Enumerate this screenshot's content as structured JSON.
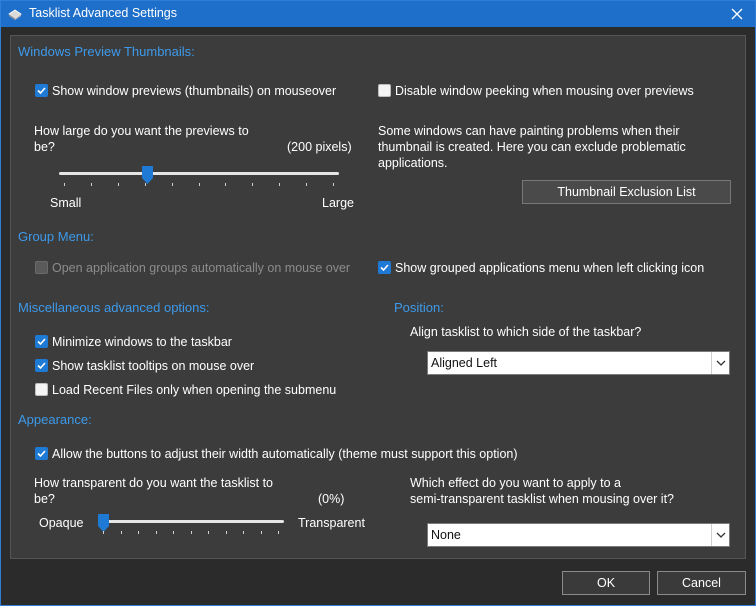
{
  "window": {
    "title": "Tasklist Advanced Settings",
    "accent": "#1e6fc9"
  },
  "thumbs": {
    "heading": "Windows Preview Thumbnails:",
    "show_previews": {
      "label": "Show window previews (thumbnails) on mouseover",
      "checked": true
    },
    "disable_peek": {
      "label": "Disable window peeking when mousing over previews",
      "checked": false
    },
    "size_question_line1": "How large do you want the previews to",
    "size_question_line2": "be?",
    "size_value": "(200 pixels)",
    "size_slider_fraction": 0.31,
    "size_min_label": "Small",
    "size_max_label": "Large",
    "exclusion_text_line1": "Some windows can have painting problems when their",
    "exclusion_text_line2": "thumbnail is created. Here you can exclude problematic",
    "exclusion_text_line3": "applications.",
    "exclusion_button": "Thumbnail Exclusion List"
  },
  "group": {
    "heading": "Group Menu:",
    "open_auto": {
      "label": "Open application groups automatically on mouse over",
      "checked": false,
      "enabled": false
    },
    "show_grouped": {
      "label": "Show grouped applications menu when left clicking icon",
      "checked": true
    }
  },
  "misc": {
    "heading": "Miscellaneous advanced options:",
    "minimize": {
      "label": "Minimize windows to the taskbar",
      "checked": true
    },
    "tooltips": {
      "label": "Show tasklist tooltips on mouse over",
      "checked": true
    },
    "recent": {
      "label": "Load Recent Files only when opening the submenu",
      "checked": false
    }
  },
  "position": {
    "heading": "Position:",
    "question": "Align tasklist to which side of the taskbar?",
    "selected": "Aligned Left"
  },
  "appearance": {
    "heading": "Appearance:",
    "auto_width": {
      "label": "Allow the buttons to adjust their width automatically (theme must support this option)",
      "checked": true
    },
    "transp_question_line1": "How transparent do you want the tasklist to",
    "transp_question_line2": "be?",
    "transp_value": "(0%)",
    "transp_slider_fraction": 0.0,
    "transp_min_label": "Opaque",
    "transp_max_label": "Transparent",
    "effect_question_line1": "Which effect do you want to apply to a",
    "effect_question_line2": "semi-transparent tasklist when mousing over it?",
    "effect_selected": "None"
  },
  "footer": {
    "ok": "OK",
    "cancel": "Cancel"
  }
}
